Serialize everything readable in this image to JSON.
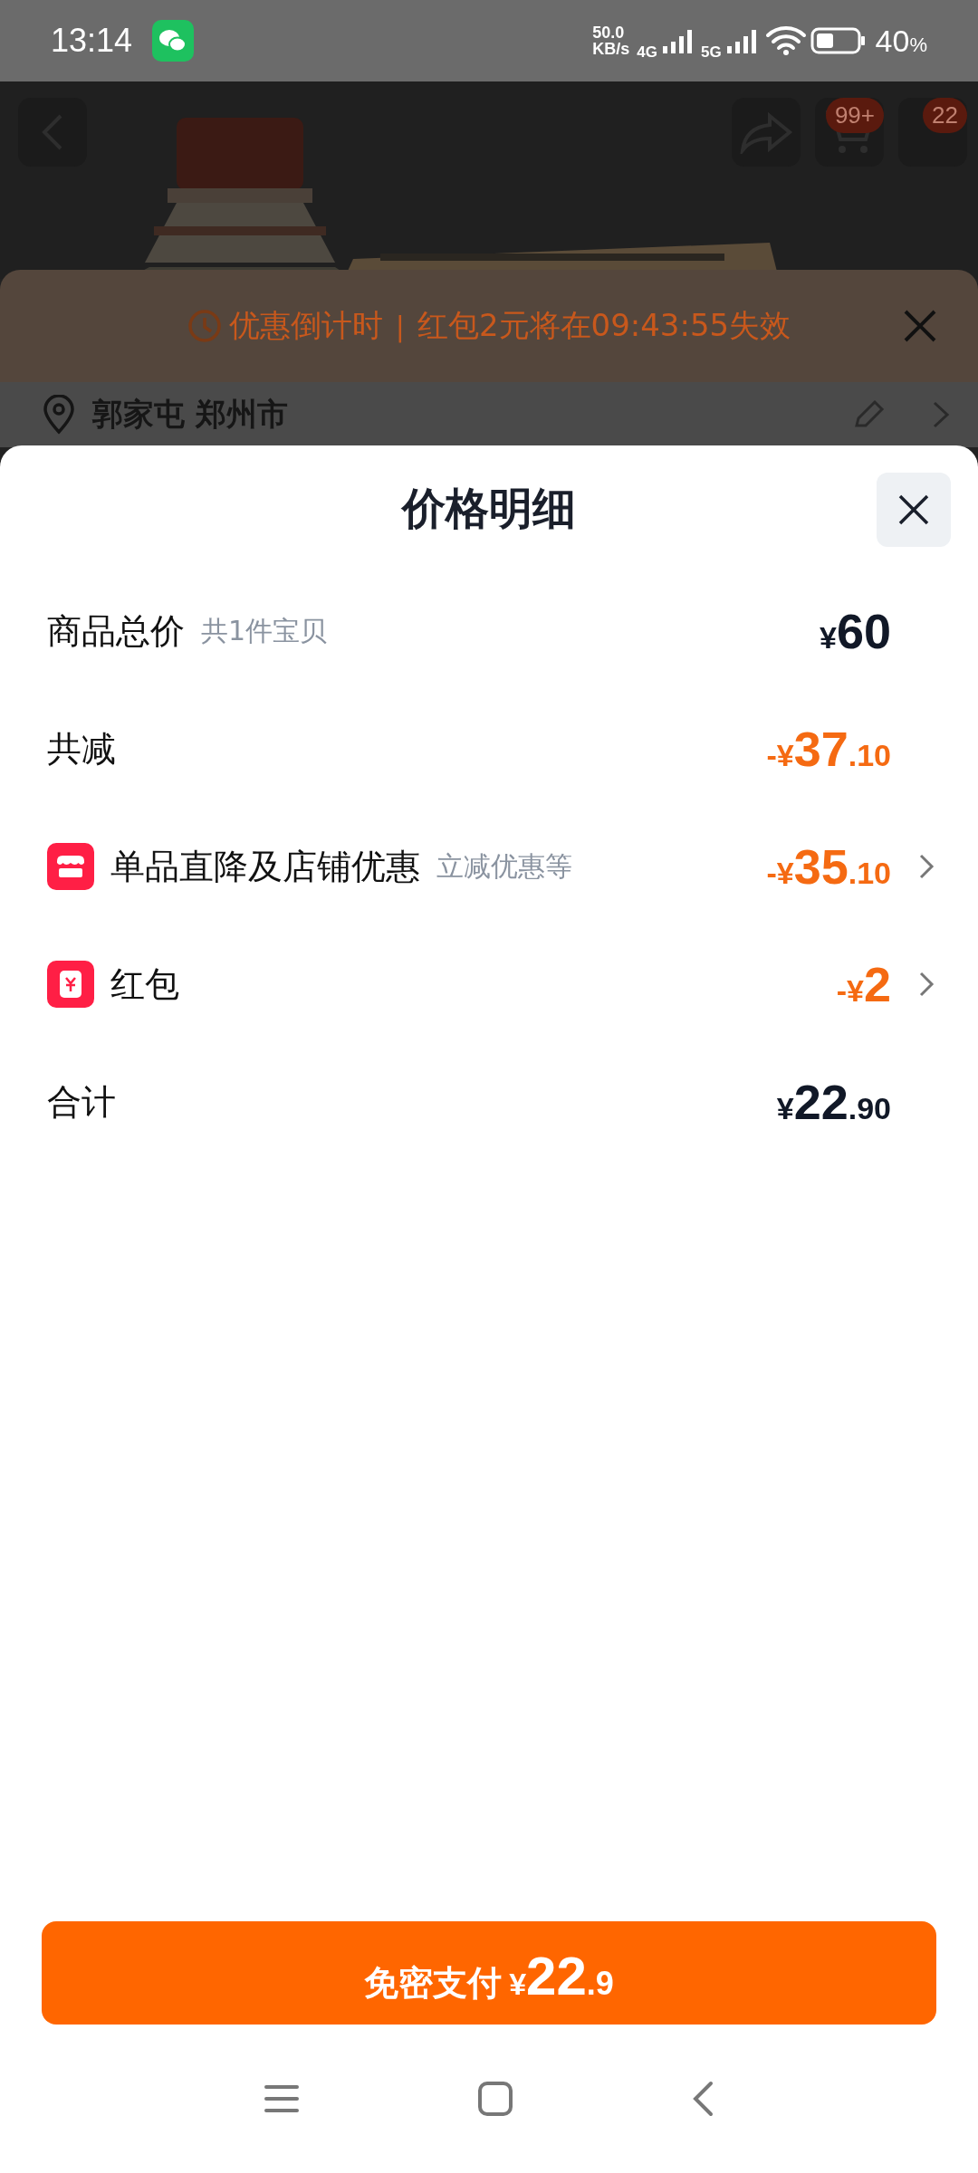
{
  "status_bar": {
    "time": "13:14",
    "speed": "50.0",
    "speed_unit": "KB/s",
    "net1": "4G",
    "net2": "5G",
    "battery": "40",
    "battery_unit": "%"
  },
  "header": {
    "cart_badge": "99+",
    "message_badge": "22"
  },
  "countdown_banner": {
    "label": "优惠倒计时",
    "separator": "|",
    "text": "红包2元将在09:43:55失效"
  },
  "address": {
    "text": "郭家屯 郑州市"
  },
  "sheet": {
    "title": "价格明细",
    "rows": [
      {
        "kind": "plain",
        "label": "商品总价",
        "sub": "共1件宝贝",
        "sign": "¥",
        "int": "60",
        "dec": ""
      },
      {
        "kind": "discount",
        "label": "共减",
        "sign": "-¥",
        "int": "37",
        "dec": ".10"
      },
      {
        "kind": "store",
        "label": "单品直降及店铺优惠",
        "sub": "立减优惠等",
        "sign": "-¥",
        "int": "35",
        "dec": ".10"
      },
      {
        "kind": "packet",
        "label": "红包",
        "sign": "-¥",
        "int": "2",
        "dec": ""
      },
      {
        "kind": "plain",
        "label": "合计",
        "sign": "¥",
        "int": "22",
        "dec": ".90"
      }
    ]
  },
  "pay_button": {
    "label": "免密支付",
    "sign": "¥",
    "int": "22",
    "dec": ".9"
  }
}
